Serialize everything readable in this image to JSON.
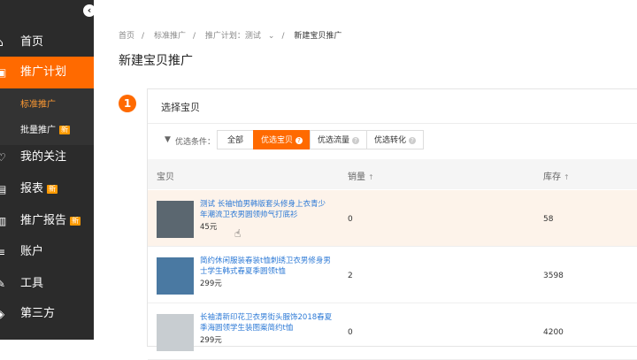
{
  "sidebar": {
    "collapse_icon": "chevron-left-icon",
    "items": [
      {
        "label": "首页",
        "icon": "home-icon"
      },
      {
        "label": "推广计划",
        "icon": "promotion-icon"
      },
      {
        "label": "我的关注",
        "icon": "heart-icon"
      },
      {
        "label": "报表",
        "icon": "chart-icon",
        "badge": "新"
      },
      {
        "label": "推广报告",
        "icon": "report-icon",
        "badge": "新"
      },
      {
        "label": "账户",
        "icon": "account-icon"
      },
      {
        "label": "工具",
        "icon": "tools-icon"
      },
      {
        "label": "第三方",
        "icon": "thirdparty-icon"
      }
    ],
    "sub_items": [
      {
        "label": "标准推广"
      },
      {
        "label": "批量推广",
        "badge": "新"
      }
    ]
  },
  "breadcrumb": {
    "items": [
      "首页",
      "标准推广",
      "推广计划：测试",
      "新建宝贝推广"
    ]
  },
  "page_title": "新建宝贝推广",
  "step": {
    "number": "1",
    "title": "选择宝贝"
  },
  "filter": {
    "label": "优选条件：",
    "tabs": [
      {
        "label": "全部"
      },
      {
        "label": "优选宝贝",
        "active": true,
        "help": "?"
      },
      {
        "label": "优选流量",
        "help": "?"
      },
      {
        "label": "优选转化",
        "help": "?"
      }
    ]
  },
  "table": {
    "headers": {
      "product": "宝贝",
      "sales": "销量",
      "stock": "库存"
    },
    "sort_icon": "↑",
    "rows": [
      {
        "title": "测试 长袖t恤男韩版套头修身上衣青少年潮流卫衣男圆领帅气打底衫",
        "price": "45元",
        "sales": "0",
        "stock": "58"
      },
      {
        "title": "简约休闲服装春装t恤刺绣卫衣男修身男士学生韩式春夏季圆领t恤",
        "price": "299元",
        "sales": "2",
        "stock": "3598"
      },
      {
        "title": "长袖清新印花卫衣男街头服饰2018春夏季海圆领学生装图案简约t恤",
        "price": "299元",
        "sales": "0",
        "stock": "4200"
      }
    ]
  },
  "colors": {
    "sidebar_bg": "#2b2b2b",
    "accent": "#ff6a00",
    "link": "#2d7ad6",
    "highlight_row": "#fdf3ea"
  }
}
